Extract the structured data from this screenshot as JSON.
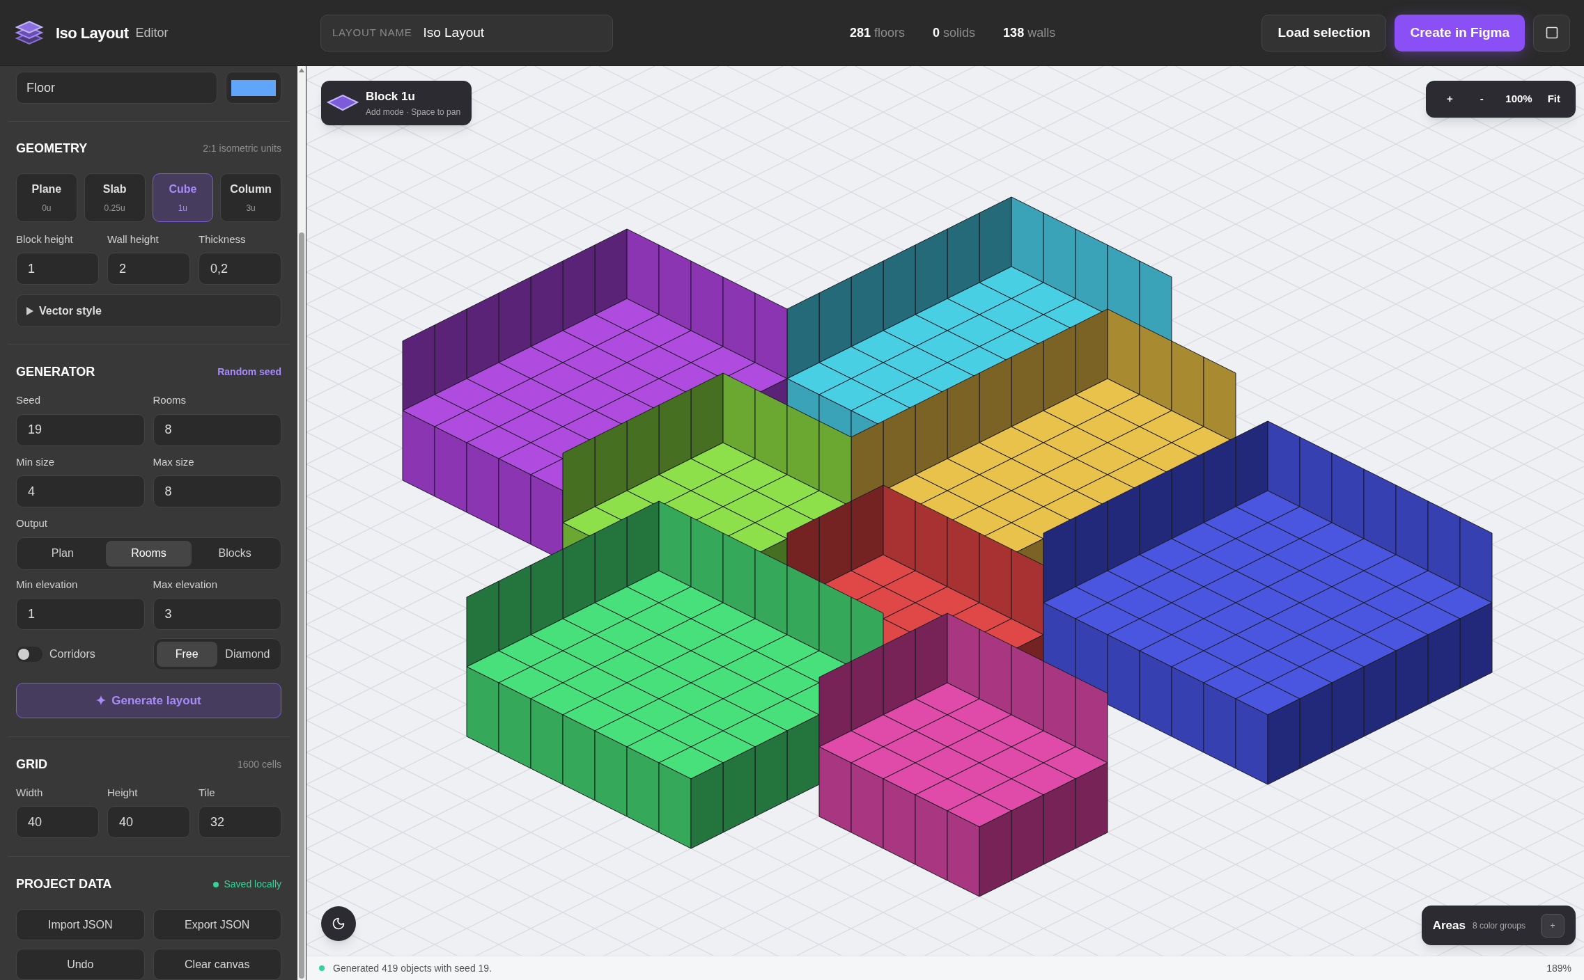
{
  "app": {
    "title": "Iso Layout",
    "subtitle": "Editor"
  },
  "layout_name": {
    "label": "LAYOUT NAME",
    "value": "Iso Layout"
  },
  "stats": [
    {
      "value": "281",
      "label": "floors"
    },
    {
      "value": "0",
      "label": "solids"
    },
    {
      "value": "138",
      "label": "walls"
    }
  ],
  "header_buttons": [
    {
      "label": "Load selection",
      "kind": "secondary"
    },
    {
      "label": "Create in Figma",
      "kind": "primary"
    }
  ],
  "sidebar": {
    "material": {
      "name": "Floor",
      "color": "#60a5fa"
    },
    "geometry": {
      "title": "GEOMETRY",
      "note": "2:1 isometric units",
      "types": [
        {
          "label": "Plane",
          "sub": "0u",
          "selected": false
        },
        {
          "label": "Slab",
          "sub": "0.25u",
          "selected": false
        },
        {
          "label": "Cube",
          "sub": "1u",
          "selected": true
        },
        {
          "label": "Column",
          "sub": "3u",
          "selected": false
        }
      ],
      "fields": [
        {
          "label": "Block height",
          "value": "1"
        },
        {
          "label": "Wall height",
          "value": "2"
        },
        {
          "label": "Thickness",
          "value": "0,2"
        }
      ],
      "vector_style": {
        "label": "Vector style",
        "expanded": false
      }
    },
    "generator": {
      "title": "GENERATOR",
      "action": "Random seed",
      "fields": [
        {
          "label": "Seed",
          "value": "19"
        },
        {
          "label": "Rooms",
          "value": "8"
        },
        {
          "label": "Min size",
          "value": "4"
        },
        {
          "label": "Max size",
          "value": "8"
        }
      ],
      "output": {
        "label": "Output",
        "options": [
          {
            "label": "Plan",
            "selected": false
          },
          {
            "label": "Rooms",
            "selected": true
          },
          {
            "label": "Blocks",
            "selected": false
          }
        ]
      },
      "elevation_fields": [
        {
          "label": "Min elevation",
          "value": "1"
        },
        {
          "label": "Max elevation",
          "value": "3"
        }
      ],
      "corridors": {
        "label": "Corridors",
        "on": false
      },
      "modes": [
        {
          "label": "Free",
          "selected": true
        },
        {
          "label": "Diamond",
          "selected": false
        }
      ],
      "generate": "Generate layout"
    },
    "grid": {
      "title": "GRID",
      "note": "1600 cells",
      "fields": [
        {
          "label": "Width",
          "value": "40"
        },
        {
          "label": "Height",
          "value": "40"
        },
        {
          "label": "Tile",
          "value": "32"
        }
      ]
    },
    "project": {
      "title": "PROJECT DATA",
      "status": "Saved locally",
      "buttons": [
        "Import JSON",
        "Export JSON",
        "Undo",
        "Clear canvas"
      ]
    }
  },
  "canvas": {
    "tool": {
      "title": "Block 1u",
      "hint": "Add mode · Space to pan"
    },
    "zoom": {
      "buttons": [
        "+",
        "-"
      ],
      "level": "100%",
      "fit": "Fit"
    },
    "areas": {
      "title": "Areas",
      "note": "8 color groups",
      "button": "+"
    }
  },
  "status_bar": {
    "message": "Generated 419 objects with seed 19.",
    "zoom": "189%"
  }
}
